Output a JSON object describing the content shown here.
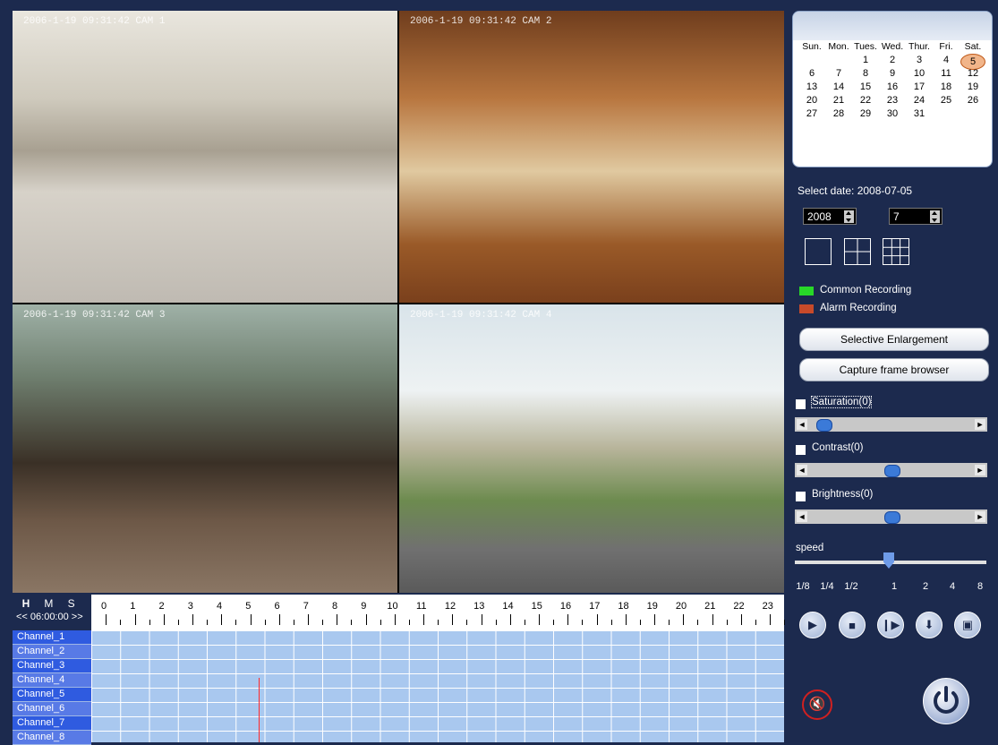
{
  "cameras": [
    {
      "osd": "2006-1-19  09:31:42 CAM 1"
    },
    {
      "osd": "2006-1-19  09:31:42 CAM 2"
    },
    {
      "osd": "2006-1-19  09:31:42 CAM 3"
    },
    {
      "osd": "2006-1-19  09:31:42 CAM 4"
    }
  ],
  "timeline": {
    "units": {
      "h": "H",
      "m": "M",
      "s": "S"
    },
    "range": "<< 06:00:00 >>",
    "hours": [
      "0",
      "1",
      "2",
      "3",
      "4",
      "5",
      "6",
      "7",
      "8",
      "9",
      "10",
      "11",
      "12",
      "13",
      "14",
      "15",
      "16",
      "17",
      "18",
      "19",
      "20",
      "21",
      "22",
      "23"
    ],
    "channels": [
      "Channel_1",
      "Channel_2",
      "Channel_3",
      "Channel_4",
      "Channel_5",
      "Channel_6",
      "Channel_7",
      "Channel_8"
    ],
    "cursor_hour": 5.8
  },
  "calendar": {
    "weekdays": [
      "Sun.",
      "Mon.",
      "Tues.",
      "Wed.",
      "Thur.",
      "Fri.",
      "Sat."
    ],
    "weeks": [
      [
        "",
        "",
        "1",
        "2",
        "3",
        "4",
        "5"
      ],
      [
        "6",
        "7",
        "8",
        "9",
        "10",
        "11",
        "12"
      ],
      [
        "13",
        "14",
        "15",
        "16",
        "17",
        "18",
        "19"
      ],
      [
        "20",
        "21",
        "22",
        "23",
        "24",
        "25",
        "26"
      ],
      [
        "27",
        "28",
        "29",
        "30",
        "31",
        "",
        ""
      ]
    ],
    "selected_day": "5"
  },
  "panel": {
    "select_date": "Select date: 2008-07-05",
    "year": "2008",
    "month": "7",
    "legend_common": "Common Recording",
    "legend_alarm": "Alarm Recording",
    "btn_enlarge": "Selective Enlargement",
    "btn_capture": "Capture frame browser",
    "saturation": "Saturation(0)",
    "contrast": "Contrast(0)",
    "brightness": "Brightness(0)",
    "speed": "speed",
    "speed_labels": [
      "1/8",
      "1/4",
      "1/2",
      "1",
      "2",
      "4",
      "8"
    ]
  },
  "colors": {
    "common": "#28d828",
    "alarm": "#c84a2a",
    "background": "#1c2a4e"
  }
}
